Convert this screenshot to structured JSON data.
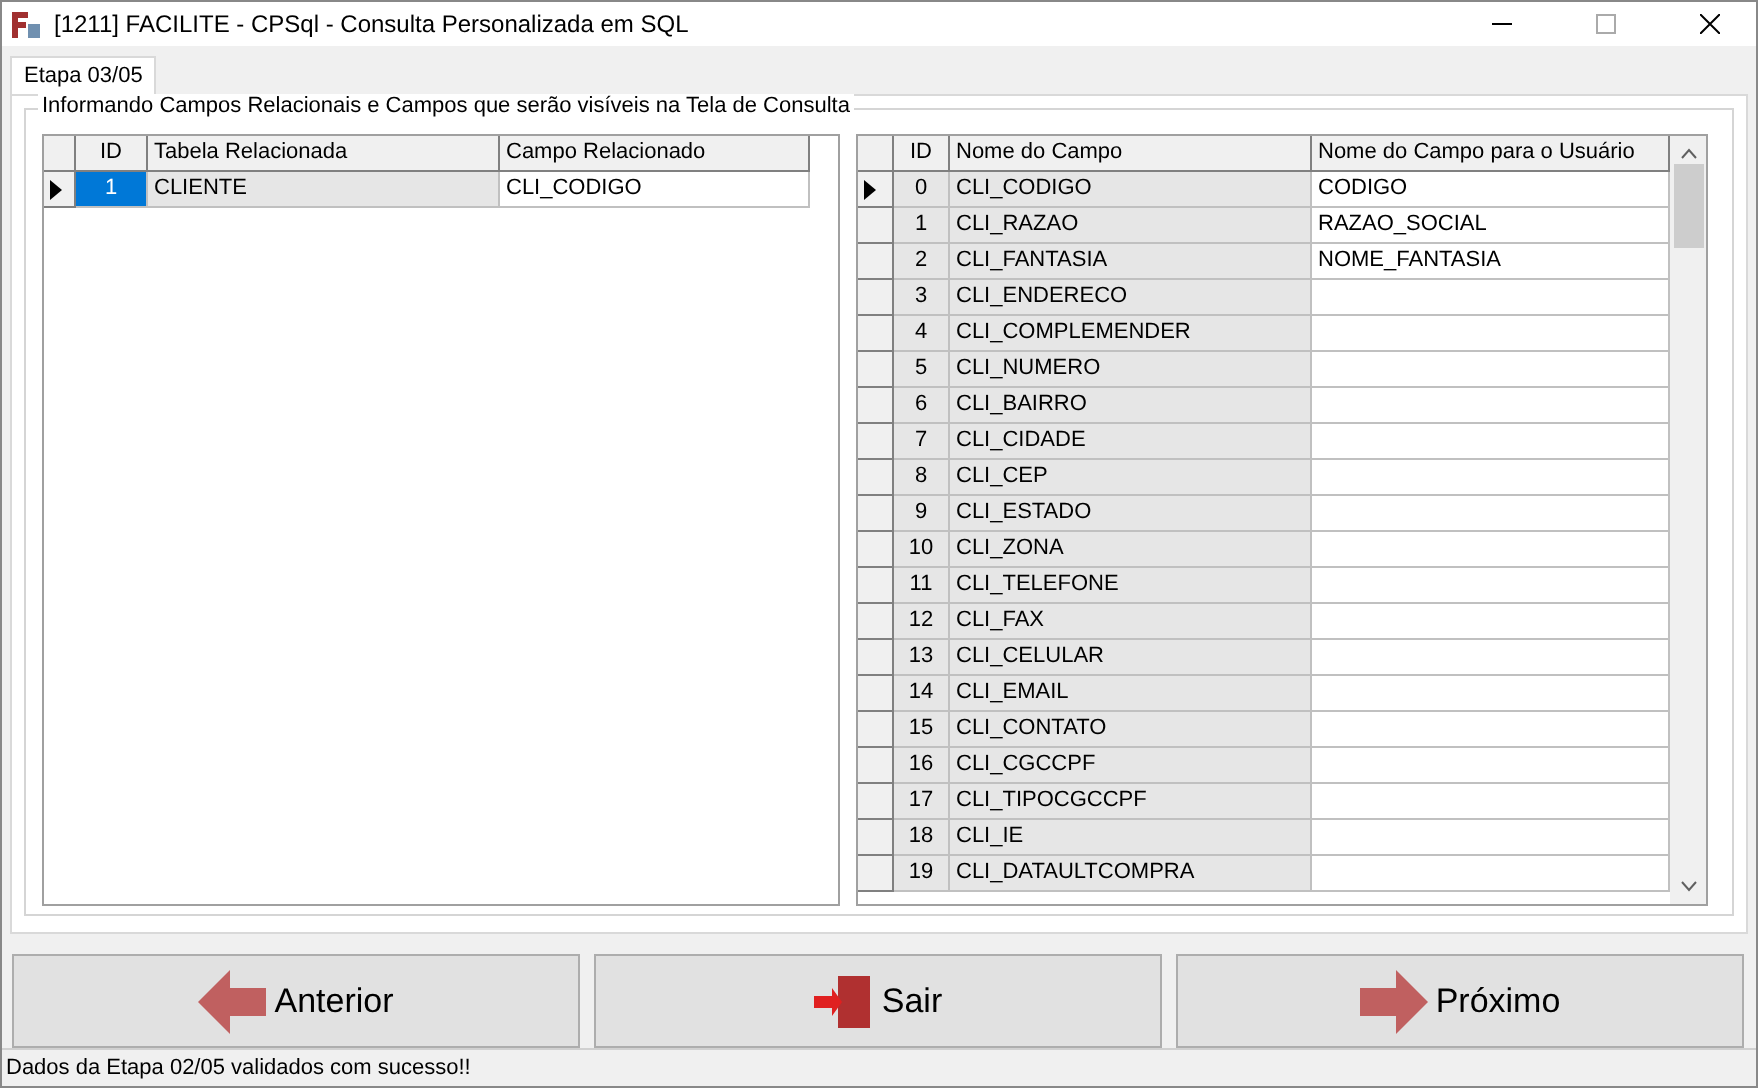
{
  "window": {
    "title": "[1211] FACILITE - CPSql - Consulta Personalizada em SQL"
  },
  "tabs": [
    {
      "label": "Etapa 03/05",
      "selected": true
    }
  ],
  "group": {
    "title": "Informando Campos Relacionais e Campos que serão visíveis na Tela de Consulta"
  },
  "left_table": {
    "columns": [
      "ID",
      "Tabela Relacionada",
      "Campo Relacionado"
    ],
    "rows": [
      {
        "selected": true,
        "cells": [
          "1",
          "CLIENTE",
          "CLI_CODIGO"
        ]
      }
    ]
  },
  "right_table": {
    "columns": [
      "ID",
      "Nome do Campo",
      "Nome do Campo para o Usuário"
    ],
    "rows": [
      {
        "selected": true,
        "cells": [
          "0",
          "CLI_CODIGO",
          "CODIGO"
        ]
      },
      {
        "selected": false,
        "cells": [
          "1",
          "CLI_RAZAO",
          "RAZAO_SOCIAL"
        ]
      },
      {
        "selected": false,
        "cells": [
          "2",
          "CLI_FANTASIA",
          "NOME_FANTASIA"
        ]
      },
      {
        "selected": false,
        "cells": [
          "3",
          "CLI_ENDERECO",
          ""
        ]
      },
      {
        "selected": false,
        "cells": [
          "4",
          "CLI_COMPLEMENDER",
          ""
        ]
      },
      {
        "selected": false,
        "cells": [
          "5",
          "CLI_NUMERO",
          ""
        ]
      },
      {
        "selected": false,
        "cells": [
          "6",
          "CLI_BAIRRO",
          ""
        ]
      },
      {
        "selected": false,
        "cells": [
          "7",
          "CLI_CIDADE",
          ""
        ]
      },
      {
        "selected": false,
        "cells": [
          "8",
          "CLI_CEP",
          ""
        ]
      },
      {
        "selected": false,
        "cells": [
          "9",
          "CLI_ESTADO",
          ""
        ]
      },
      {
        "selected": false,
        "cells": [
          "10",
          "CLI_ZONA",
          ""
        ]
      },
      {
        "selected": false,
        "cells": [
          "11",
          "CLI_TELEFONE",
          ""
        ]
      },
      {
        "selected": false,
        "cells": [
          "12",
          "CLI_FAX",
          ""
        ]
      },
      {
        "selected": false,
        "cells": [
          "13",
          "CLI_CELULAR",
          ""
        ]
      },
      {
        "selected": false,
        "cells": [
          "14",
          "CLI_EMAIL",
          ""
        ]
      },
      {
        "selected": false,
        "cells": [
          "15",
          "CLI_CONTATO",
          ""
        ]
      },
      {
        "selected": false,
        "cells": [
          "16",
          "CLI_CGCCPF",
          ""
        ]
      },
      {
        "selected": false,
        "cells": [
          "17",
          "CLI_TIPOCGCCPF",
          ""
        ]
      },
      {
        "selected": false,
        "cells": [
          "18",
          "CLI_IE",
          ""
        ]
      },
      {
        "selected": false,
        "cells": [
          "19",
          "CLI_DATAULTCOMPRA",
          ""
        ]
      }
    ]
  },
  "buttons": [
    {
      "kind": "back",
      "label": "Anterior"
    },
    {
      "kind": "exit",
      "label": "Sair"
    },
    {
      "kind": "next",
      "label": "Próximo"
    }
  ],
  "status_bar": "Dados da Etapa 02/05 validados com sucesso!!"
}
